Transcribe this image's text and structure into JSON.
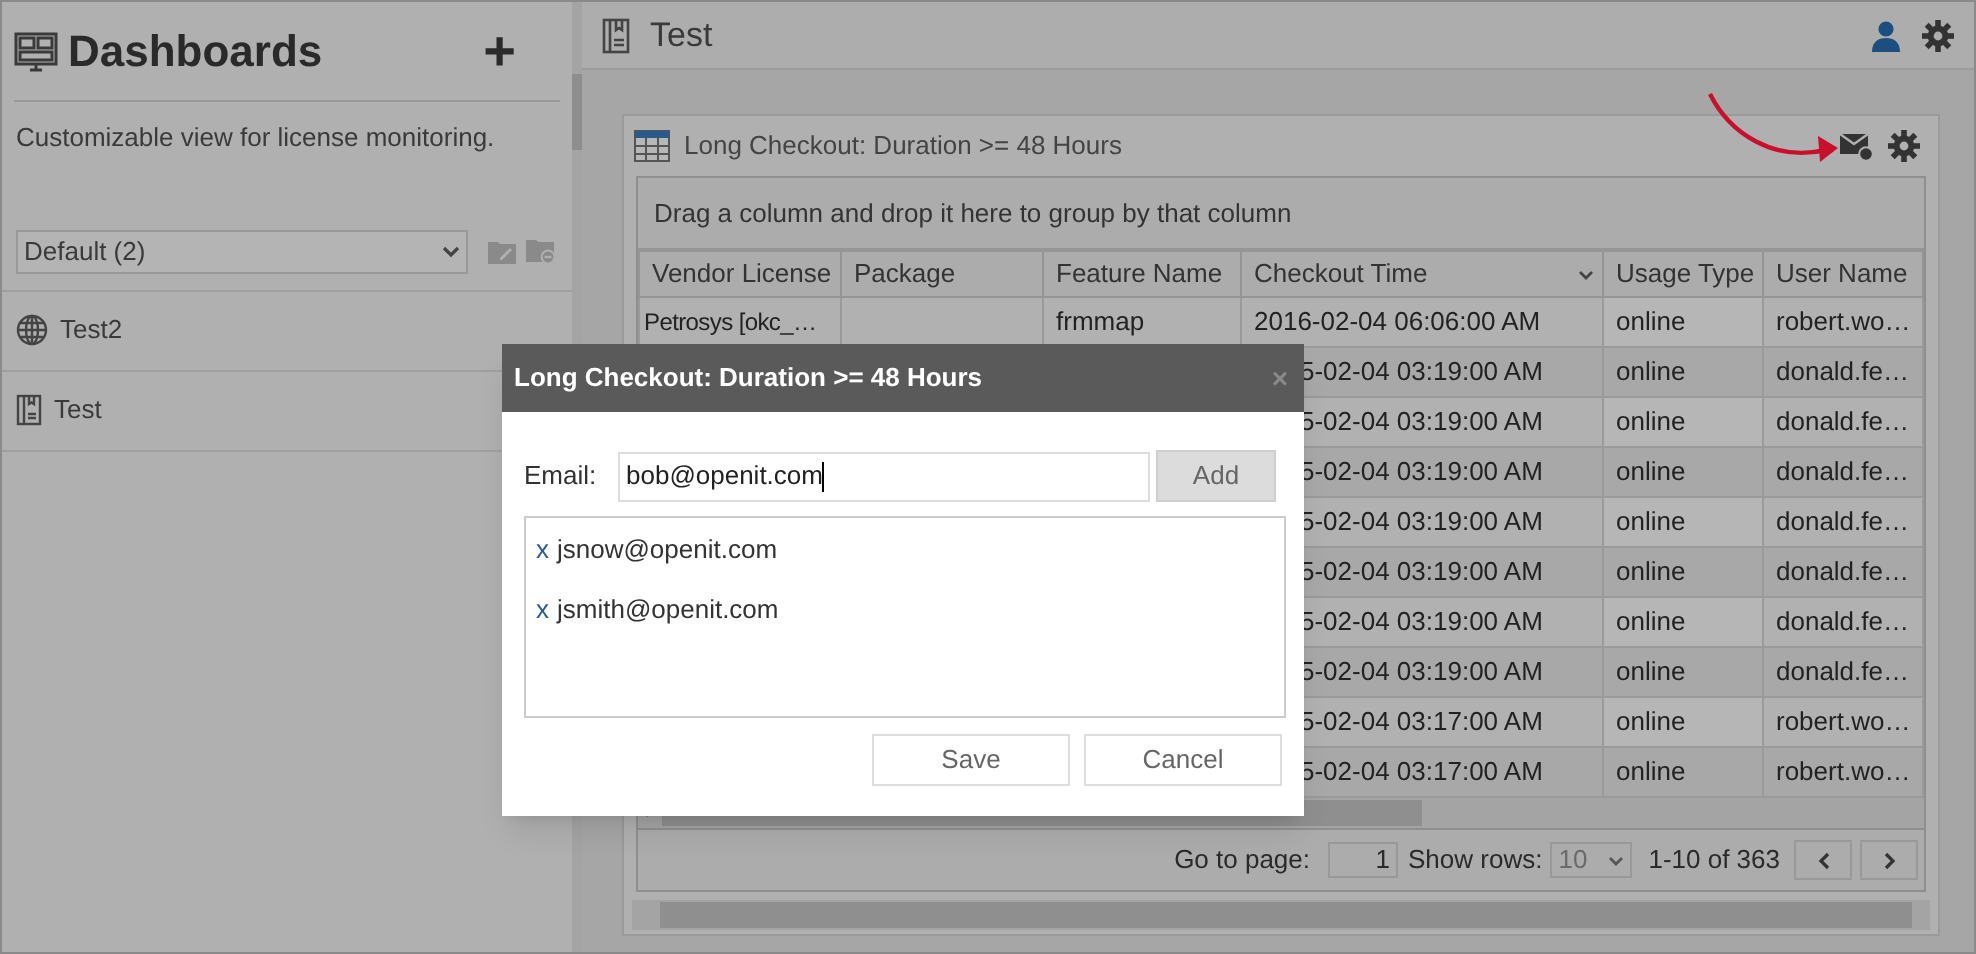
{
  "sidebar": {
    "title": "Dashboards",
    "add": "+",
    "description": "Customizable view for license monitoring.",
    "select": {
      "value": "Default (2)"
    },
    "items": [
      {
        "label": "Test2",
        "kind": "globe"
      },
      {
        "label": "Test",
        "kind": "notebook"
      }
    ]
  },
  "header": {
    "title": "Test"
  },
  "widget": {
    "title": "Long Checkout: Duration >= 48 Hours",
    "group_hint": "Drag a column and drop it here to group by that column",
    "columns": [
      {
        "label": "Vendor License",
        "sorted": false
      },
      {
        "label": "Package",
        "sorted": false
      },
      {
        "label": "Feature Name",
        "sorted": false
      },
      {
        "label": "Checkout Time",
        "sorted": true
      },
      {
        "label": "Usage Type",
        "sorted": false
      },
      {
        "label": "User Name",
        "sorted": false
      }
    ],
    "rows": [
      [
        "Petrosys [okc_…",
        "",
        "frmmap",
        "2016-02-04 06:06:00 AM",
        "online",
        "robert.wo…"
      ],
      [
        "",
        "",
        "",
        "5-02-04 03:19:00 AM",
        "online",
        "donald.fe…"
      ],
      [
        "",
        "",
        "",
        "5-02-04 03:19:00 AM",
        "online",
        "donald.fe…"
      ],
      [
        "",
        "",
        "",
        "5-02-04 03:19:00 AM",
        "online",
        "donald.fe…"
      ],
      [
        "",
        "",
        "",
        "5-02-04 03:19:00 AM",
        "online",
        "donald.fe…"
      ],
      [
        "",
        "",
        "",
        "5-02-04 03:19:00 AM",
        "online",
        "donald.fe…"
      ],
      [
        "",
        "",
        "",
        "5-02-04 03:19:00 AM",
        "online",
        "donald.fe…"
      ],
      [
        "",
        "",
        "",
        "5-02-04 03:19:00 AM",
        "online",
        "donald.fe…"
      ],
      [
        "",
        "",
        "",
        "5-02-04 03:17:00 AM",
        "online",
        "robert.wo…"
      ],
      [
        "",
        "",
        "",
        "5-02-04 03:17:00 AM",
        "online",
        "robert.wo…"
      ]
    ],
    "pager": {
      "go_to_label": "Go to page:",
      "page": "1",
      "show_rows_label": "Show rows:",
      "rows_value": "10",
      "range": "1-10 of 363"
    }
  },
  "dialog": {
    "title": "Long Checkout: Duration >= 48 Hours",
    "close": "×",
    "email_label": "Email:",
    "email_value": "bob@openit.com",
    "add_button": "Add",
    "recipients": [
      {
        "remove": "x",
        "email": "jsnow@openit.com"
      },
      {
        "remove": "x",
        "email": "jsmith@openit.com"
      }
    ],
    "buttons": [
      "Save",
      "Cancel"
    ]
  }
}
